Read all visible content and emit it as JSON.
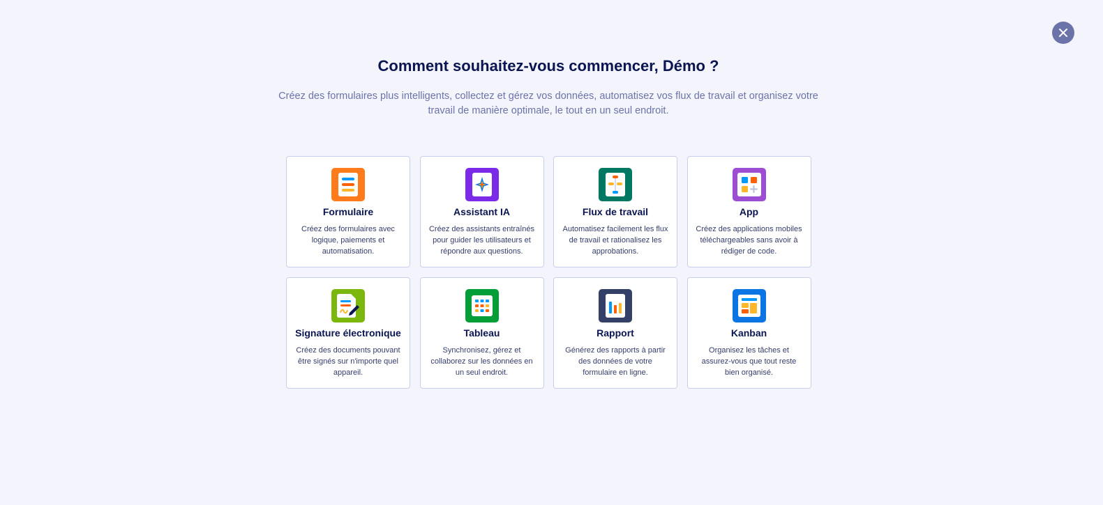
{
  "header": {
    "title": "Comment souhaitez-vous commencer, Démo ?",
    "subtitle": "Créez des formulaires plus intelligents, collectez et gérez vos données, automatisez vos flux de travail et organisez votre travail de manière optimale, le tout en un seul endroit."
  },
  "close_button": {
    "icon": "close-icon"
  },
  "options": [
    {
      "title": "Formulaire",
      "description": "Créez des formulaires avec logique, paiements et automatisation.",
      "icon": "form-icon",
      "color": "#ff7b1c"
    },
    {
      "title": "Assistant IA",
      "description": "Créez des assistants entraînés pour guider les utilisateurs et répondre aux questions.",
      "icon": "ai-agent-icon",
      "color": "#7b2ae8"
    },
    {
      "title": "Flux de travail",
      "description": "Automatisez facilement les flux de travail et rationalisez les approbations.",
      "icon": "workflow-icon",
      "color": "#007862"
    },
    {
      "title": "App",
      "description": "Créez des applications mobiles téléchargeables sans avoir à rédiger de code.",
      "icon": "app-icon",
      "color": "#9c4dd3"
    },
    {
      "title": "Signature électronique",
      "description": "Créez des documents pouvant être signés sur n'importe quel appareil.",
      "icon": "signature-icon",
      "color": "#7bb70d"
    },
    {
      "title": "Tableau",
      "description": "Synchronisez, gérez et collaborez sur les données en un seul endroit.",
      "icon": "table-icon",
      "color": "#049e38"
    },
    {
      "title": "Rapport",
      "description": "Générez des rapports à partir des données de votre formulaire en ligne.",
      "icon": "report-icon",
      "color": "#344067"
    },
    {
      "title": "Kanban",
      "description": "Organisez les tâches et assurez-vous que tout reste bien organisé.",
      "icon": "kanban-icon",
      "color": "#0a75e3"
    }
  ]
}
